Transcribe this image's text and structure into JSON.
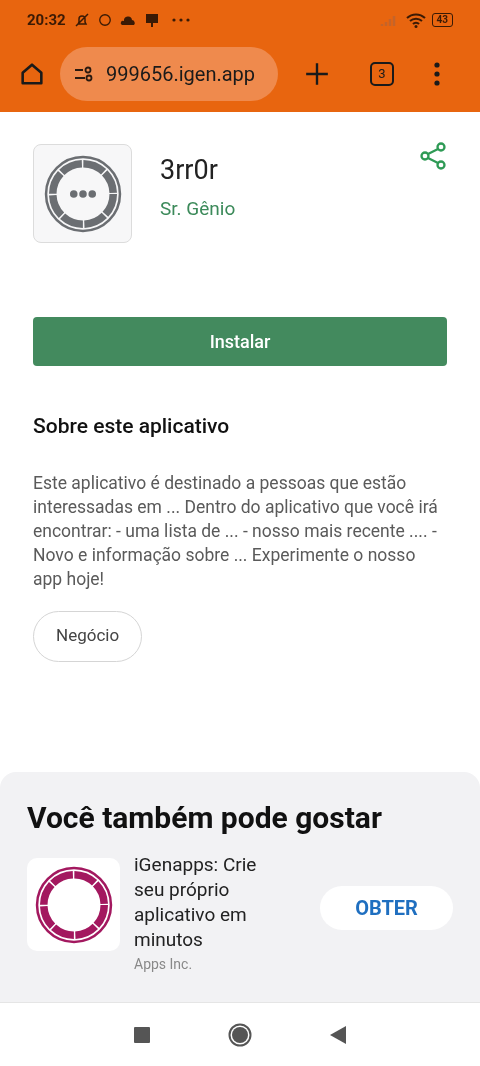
{
  "status_bar": {
    "time": "20:32",
    "battery": "43"
  },
  "browser": {
    "url": "999656.igen.app",
    "tab_count": "3"
  },
  "app": {
    "name": "3rr0r",
    "developer": "Sr. Gênio",
    "install_label": "Instalar"
  },
  "about": {
    "title": "Sobre este aplicativo",
    "description": "Este aplicativo é destinado a pessoas que estão interessadas em ... Dentro do aplicativo que você irá encontrar: - uma lista de ... - nosso mais recente .... - Novo e informação sobre ... Experimente o nosso app hoje!",
    "category": "Negócio"
  },
  "suggestions": {
    "title": "Você também pode gostar",
    "items": [
      {
        "name": "iGenapps: Crie seu próprio aplicativo em minutos",
        "developer": "Apps Inc.",
        "action": "OBTER"
      }
    ]
  }
}
